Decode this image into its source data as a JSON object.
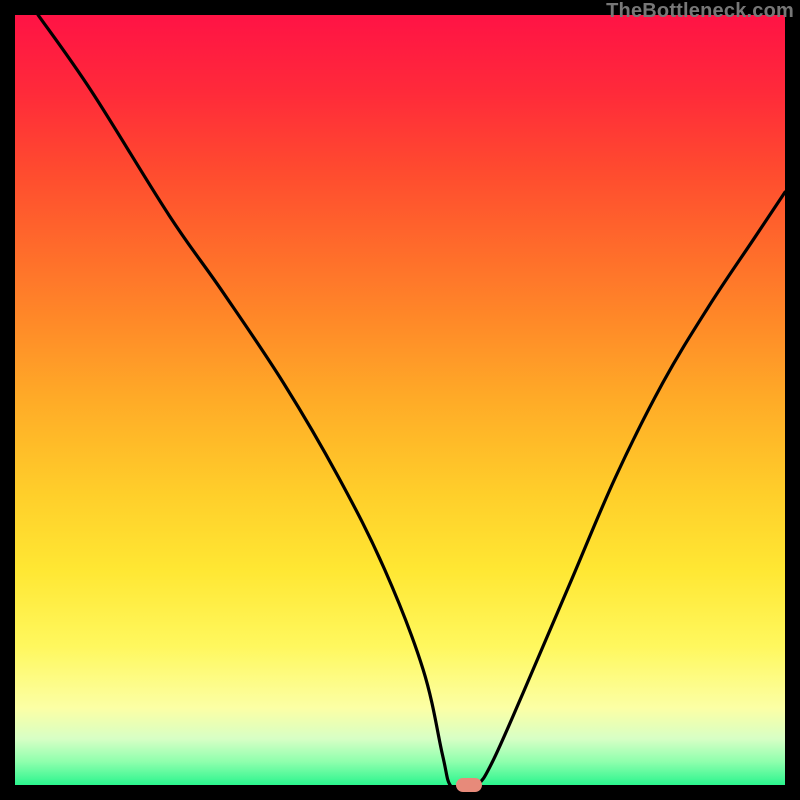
{
  "watermark": "TheBottleneck.com",
  "chart_data": {
    "type": "line",
    "title": "",
    "xlabel": "",
    "ylabel": "",
    "xlim": [
      0,
      100
    ],
    "ylim": [
      0,
      100
    ],
    "legend": false,
    "grid": false,
    "background": "rainbow-vertical-gradient",
    "series": [
      {
        "name": "bottleneck-curve",
        "x": [
          3,
          10,
          20,
          27,
          35,
          42,
          48,
          53,
          55.5,
          56.5,
          58,
          60,
          62,
          66,
          72,
          78,
          84,
          90,
          96,
          100
        ],
        "y": [
          100,
          90,
          74,
          64,
          52,
          40,
          28,
          15,
          4,
          0,
          0,
          0,
          3,
          12,
          26,
          40,
          52,
          62,
          71,
          77
        ]
      }
    ],
    "marker": {
      "x": 59,
      "y": 0,
      "shape": "pill",
      "color": "#e78a7a"
    }
  },
  "colors": {
    "page_bg": "#000000",
    "curve": "#000000",
    "marker": "#e78a7a",
    "watermark": "#777777"
  }
}
